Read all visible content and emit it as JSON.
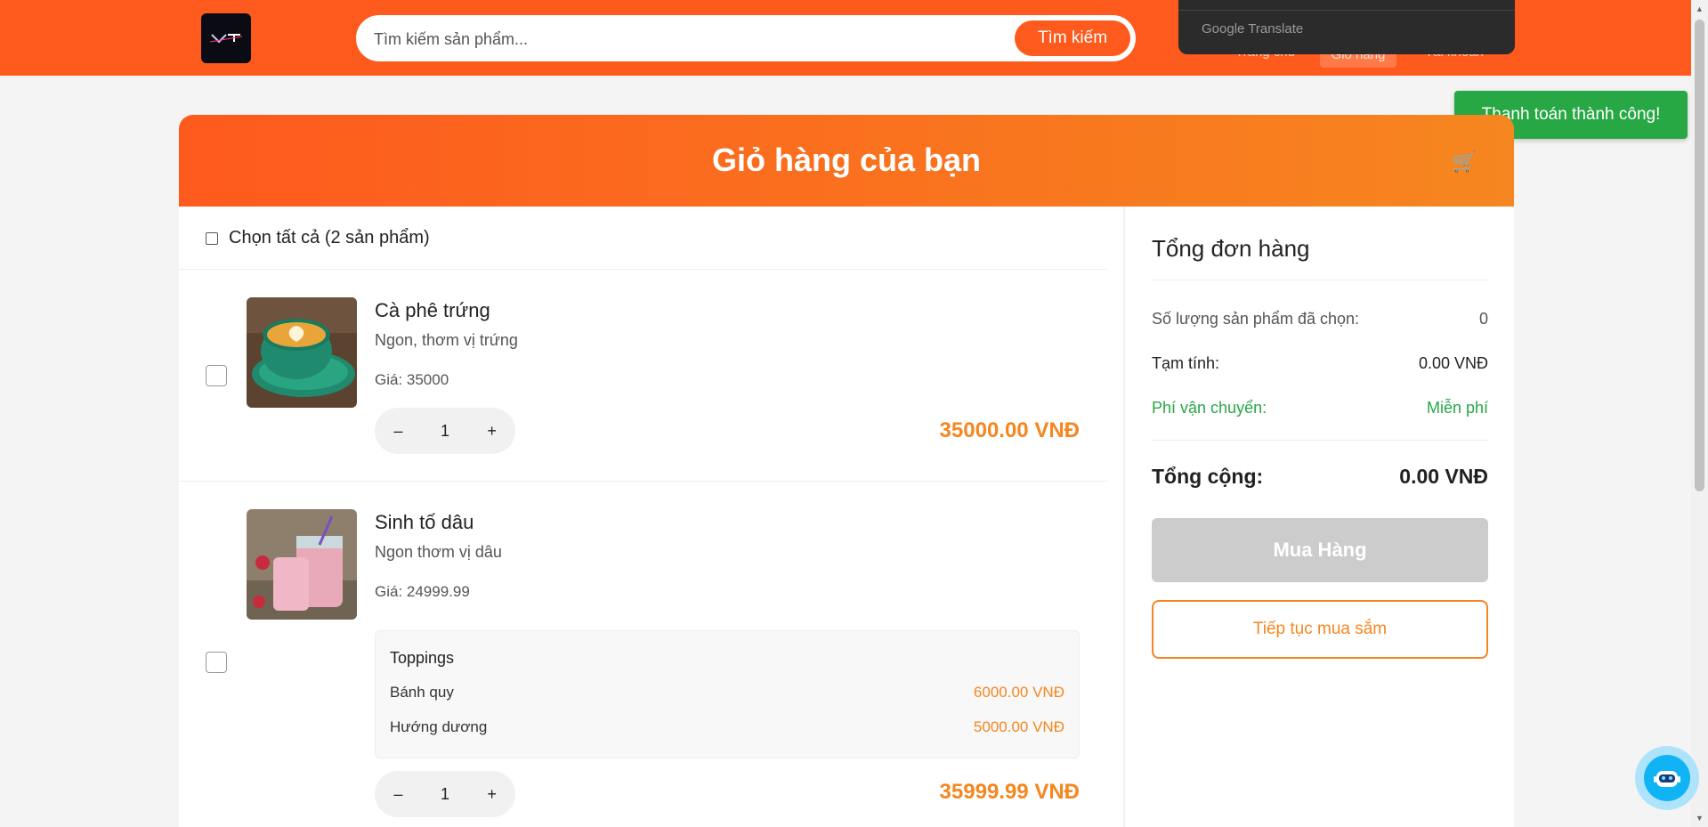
{
  "header": {
    "search_placeholder": "Tìm kiếm sản phẩm...",
    "search_button": "Tìm kiếm",
    "nav": {
      "home": "Trang chủ",
      "cart": "Giỏ hàng",
      "account": "Tài khoản"
    },
    "translate_label": "Google Translate"
  },
  "toast": "Thanh toán thành công!",
  "cart": {
    "title": "Giỏ hàng của bạn",
    "select_all": "Chọn tất cả (2 sản phẩm)",
    "items": [
      {
        "name": "Cà phê trứng",
        "desc": "Ngon, thơm vị trứng",
        "price": "Giá: 35000",
        "qty": "1",
        "minus": "–",
        "plus": "+",
        "total": "35000.00 VNĐ"
      },
      {
        "name": "Sinh tố dâu",
        "desc": "Ngon thơm vị dâu",
        "price": "Giá: 24999.99",
        "toppings_title": "Toppings",
        "toppings": [
          {
            "name": "Bánh quy",
            "price": "6000.00 VNĐ"
          },
          {
            "name": "Hướng dương",
            "price": "5000.00 VNĐ"
          }
        ],
        "qty": "1",
        "minus": "–",
        "plus": "+",
        "total": "35999.99 VNĐ"
      }
    ]
  },
  "summary": {
    "title": "Tổng đơn hàng",
    "count_label": "Số lượng sản phẩm đã chọn:",
    "count_value": "0",
    "subtotal_label": "Tạm tính:",
    "subtotal_value": "0.00 VNĐ",
    "shipping_label": "Phí vận chuyển:",
    "shipping_value": "Miễn phí",
    "total_label": "Tổng cộng:",
    "total_value": "0.00 VNĐ",
    "buy_button": "Mua Hàng",
    "continue_button": "Tiếp tục mua sắm"
  },
  "colors": {
    "brand": "#fe5a1d",
    "accent": "#f6861f",
    "success": "#28a745",
    "disabled": "#cccccc"
  }
}
